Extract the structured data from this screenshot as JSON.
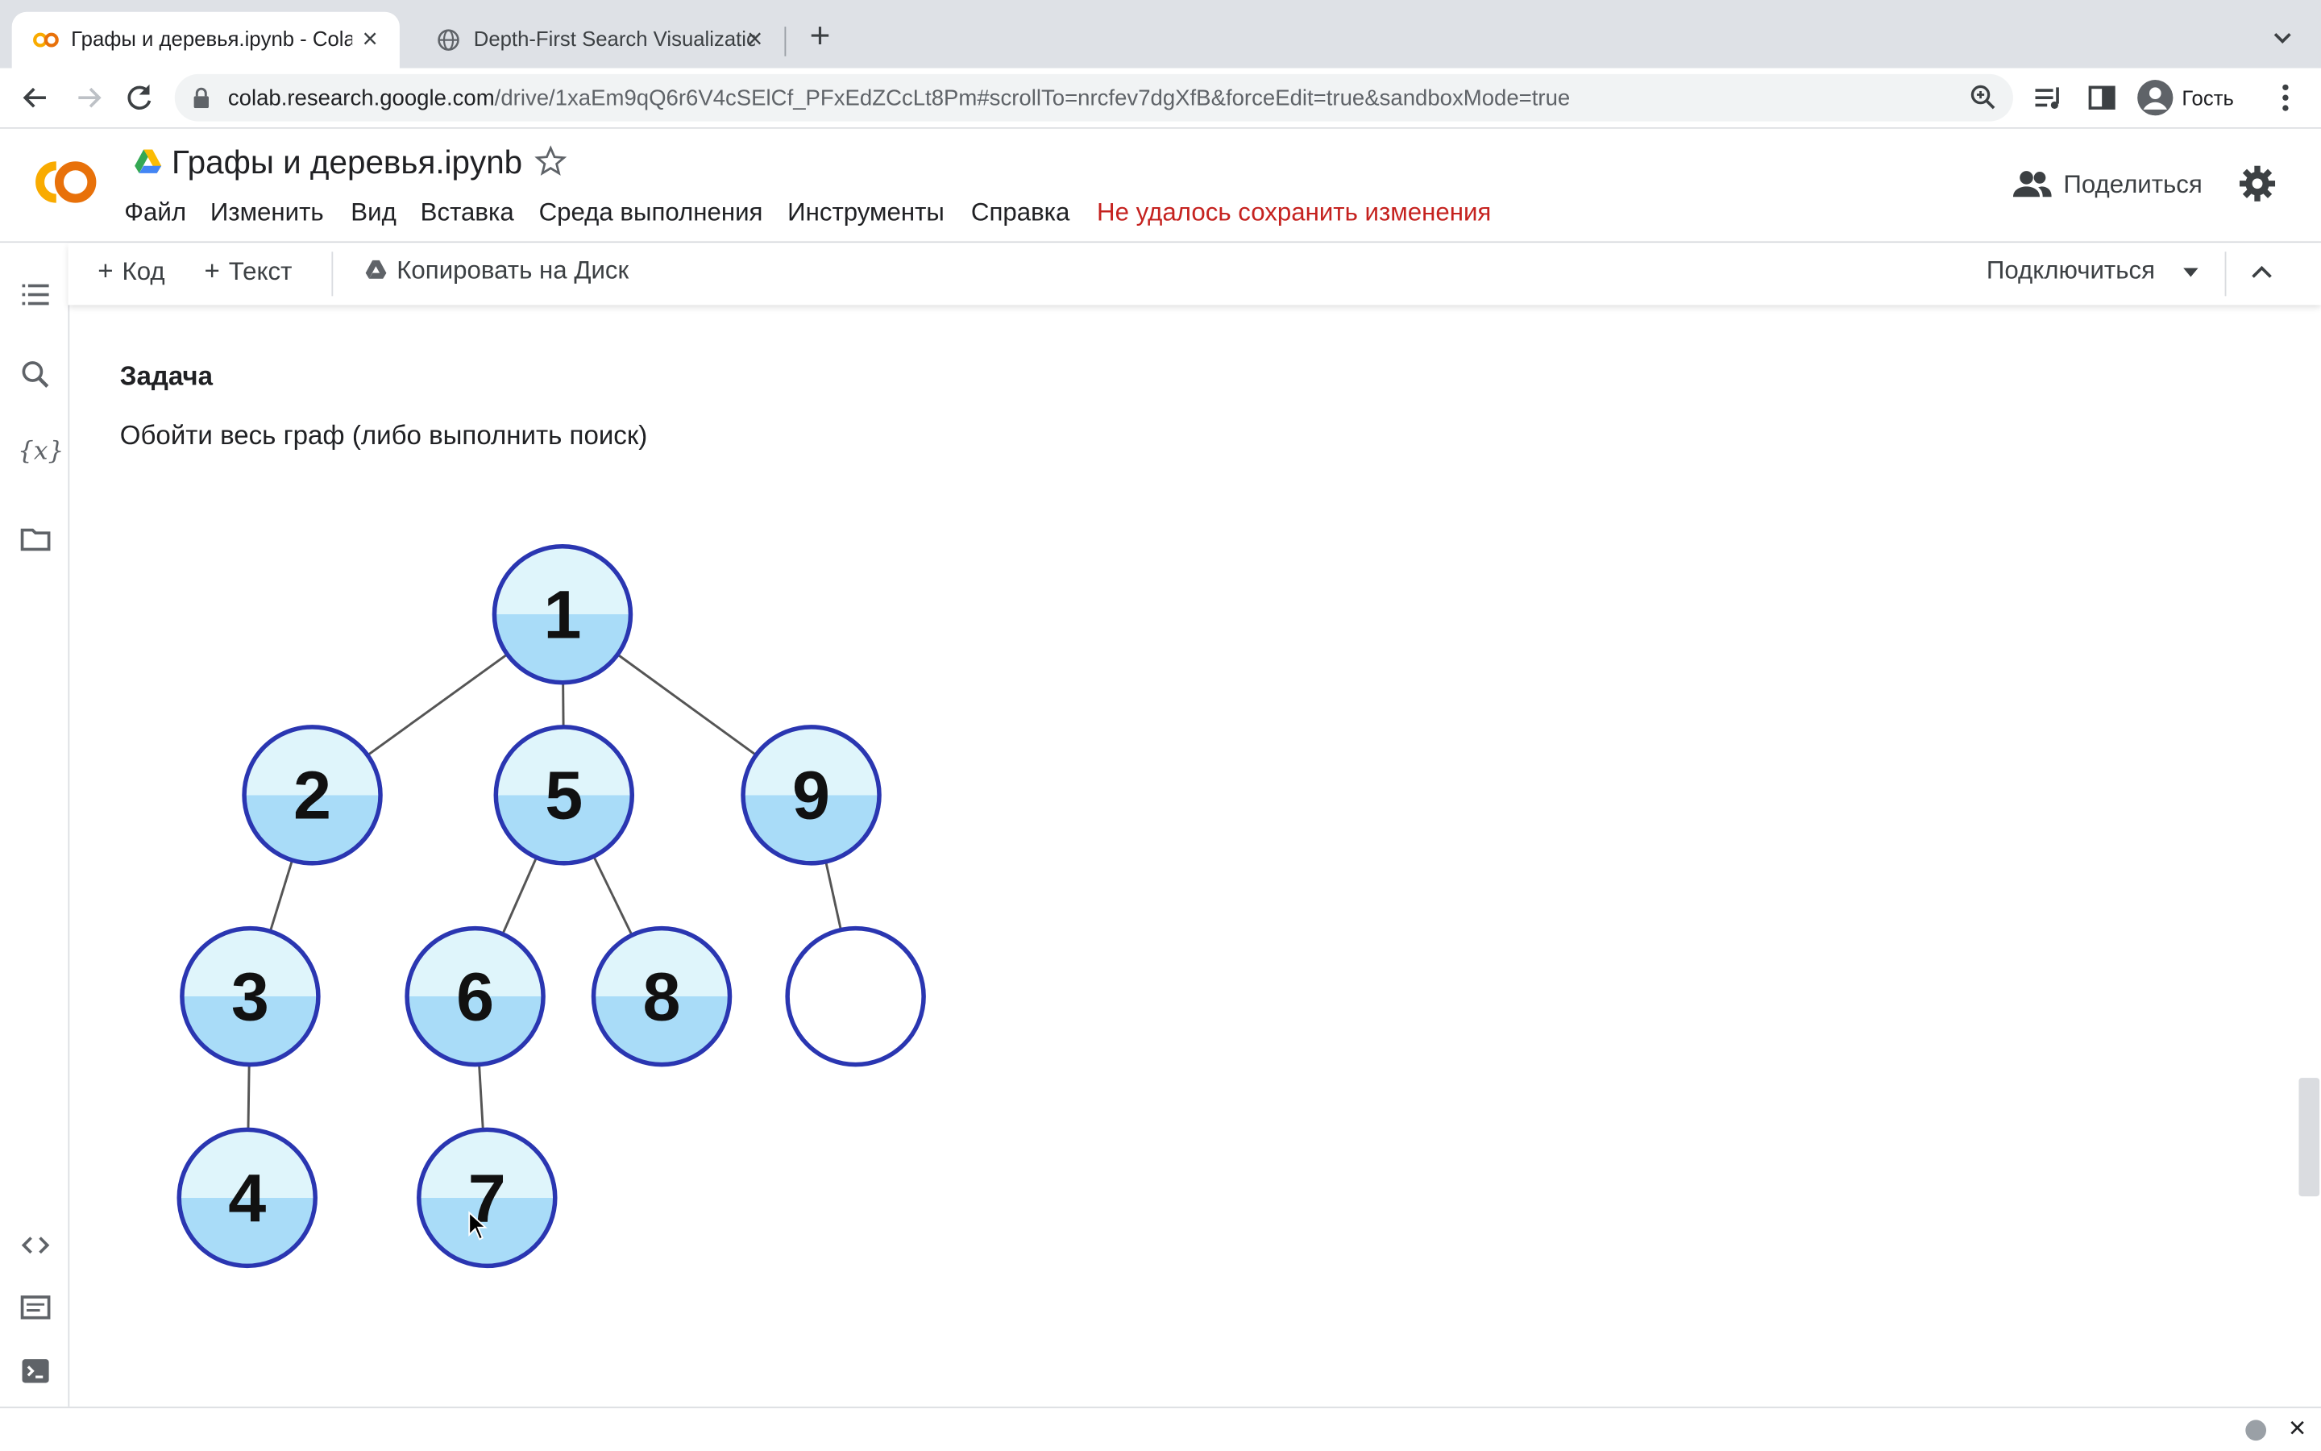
{
  "browser": {
    "tabs": [
      {
        "title": "Графы и деревья.ipynb - Colab",
        "active": true
      },
      {
        "title": "Depth-First Search Visualization",
        "active": false
      }
    ],
    "url_host": "colab.research.google.com",
    "url_path": "/drive/1xaEm9qQ6r6V4cSElCf_PFxEdZCcLt8Pm#scrollTo=nrcfev7dgXfB&forceEdit=true&sandboxMode=true",
    "profile_label": "Гость"
  },
  "colab": {
    "notebook_title": "Графы и деревья.ipynb",
    "menu": [
      "Файл",
      "Изменить",
      "Вид",
      "Вставка",
      "Среда выполнения",
      "Инструменты",
      "Справка"
    ],
    "save_warning": "Не удалось сохранить изменения",
    "share_label": "Поделиться",
    "toolbar": {
      "add_code": "Код",
      "add_text": "Текст",
      "copy_to_drive": "Копировать на Диск",
      "connect": "Подключиться"
    }
  },
  "cell": {
    "heading": "Задача",
    "text": "Обойти весь граф (либо выполнить поиск)"
  },
  "tree": {
    "fill_top": "#dff5fb",
    "fill_bottom": "#a9dcf8",
    "stroke": "#2a36b1",
    "nodes": [
      {
        "id": "n1",
        "label": "1"
      },
      {
        "id": "n2",
        "label": "2"
      },
      {
        "id": "n5",
        "label": "5"
      },
      {
        "id": "n9",
        "label": "9"
      },
      {
        "id": "n3",
        "label": "3"
      },
      {
        "id": "n6",
        "label": "6"
      },
      {
        "id": "n8",
        "label": "8"
      },
      {
        "id": "nE",
        "label": ""
      },
      {
        "id": "n4",
        "label": "4"
      },
      {
        "id": "n7",
        "label": "7"
      }
    ],
    "edges": [
      [
        "n1",
        "n2"
      ],
      [
        "n1",
        "n5"
      ],
      [
        "n1",
        "n9"
      ],
      [
        "n2",
        "n3"
      ],
      [
        "n3",
        "n4"
      ],
      [
        "n5",
        "n6"
      ],
      [
        "n5",
        "n8"
      ],
      [
        "n6",
        "n7"
      ],
      [
        "n9",
        "nE"
      ]
    ]
  }
}
